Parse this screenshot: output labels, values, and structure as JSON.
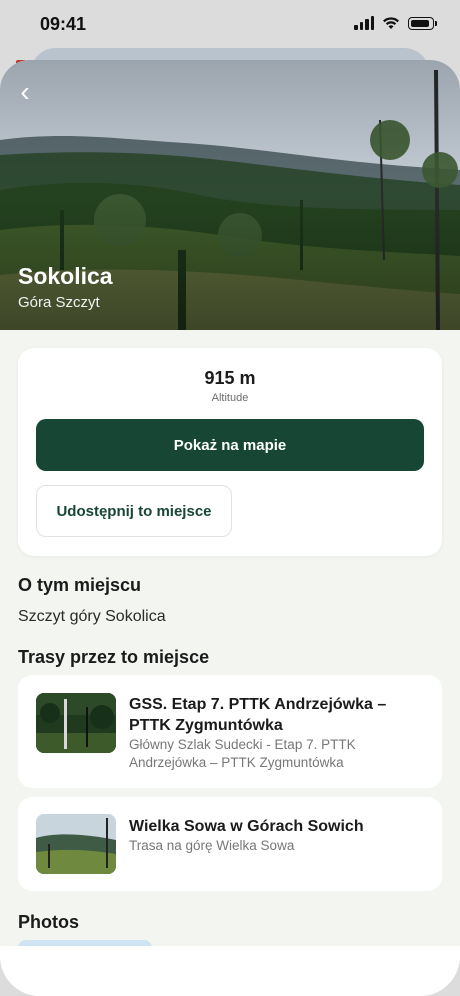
{
  "status": {
    "time": "09:41"
  },
  "place": {
    "name": "Sokolica",
    "subtitle": "Góra Szczyt"
  },
  "info": {
    "altitude_value": "915 m",
    "altitude_label": "Altitude",
    "map_button": "Pokaż na mapie",
    "share_button": "Udostępnij to miejsce"
  },
  "about": {
    "title": "O tym miejscu",
    "text": "Szczyt góry Sokolica"
  },
  "routes": {
    "title": "Trasy przez to miejsce",
    "items": [
      {
        "title": "GSS. Etap 7. PTTK Andrzejówka – PTTK Zygmuntówka",
        "description": "Główny Szlak Sudecki - Etap 7. PTTK Andrzejówka – PTTK Zygmuntówka"
      },
      {
        "title": "Wielka Sowa w Górach Sowich",
        "description": "Trasa na górę Wielka Sowa"
      }
    ]
  },
  "photos": {
    "title": "Photos"
  },
  "colors": {
    "primary": "#174734",
    "background": "#f3f5f1"
  },
  "icons": {
    "back": "chevron-left-icon"
  }
}
